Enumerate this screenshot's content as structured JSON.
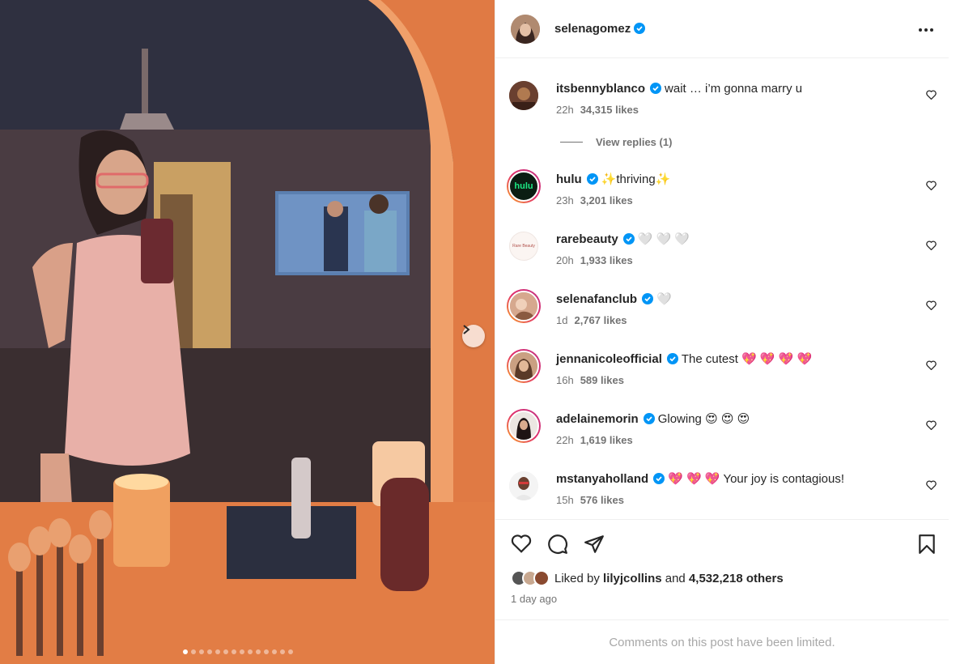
{
  "post": {
    "author": "selenagomez",
    "author_verified": true,
    "carousel": {
      "total_slides": 14,
      "current_slide": 1
    }
  },
  "comments": [
    {
      "username": "itsbennyblanco",
      "text": "wait … i’m gonna marry u",
      "time": "22h",
      "likes": "34,315 likes",
      "replies_label": "View replies (1)"
    },
    {
      "username": "hulu",
      "text": "✨thriving✨",
      "time": "23h",
      "likes": "3,201 likes",
      "avatar_text": "hulu"
    },
    {
      "username": "rarebeauty",
      "text": "🤍 🤍 🤍",
      "time": "20h",
      "likes": "1,933 likes",
      "avatar_text": "Rare Beauty"
    },
    {
      "username": "selenafanclub",
      "text": "🤍",
      "time": "1d",
      "likes": "2,767 likes"
    },
    {
      "username": "jennanicoleofficial",
      "text": "The cutest 💖 💖 💖 💖",
      "time": "16h",
      "likes": "589 likes"
    },
    {
      "username": "adelainemorin",
      "text": "Glowing 😍 😍 😍",
      "time": "22h",
      "likes": "1,619 likes"
    },
    {
      "username": "mstanyaholland",
      "text": "💖 💖 💖  Your joy is contagious!",
      "time": "15h",
      "likes": "576 likes"
    }
  ],
  "likes_summary": {
    "prefix": "Liked by",
    "user": "lilyjcollins",
    "middle": "and",
    "count": "4,532,218 others"
  },
  "time_ago": "1 day ago",
  "comments_limited": "Comments on this post have been limited.",
  "icons": [
    "more-icon",
    "heart-icon",
    "comment-icon",
    "share-icon",
    "bookmark-icon",
    "verified-icon",
    "chevron-right-icon"
  ],
  "colors": {
    "verified": "#0095f6",
    "muted": "#737373",
    "hulu": "#1ce783"
  }
}
